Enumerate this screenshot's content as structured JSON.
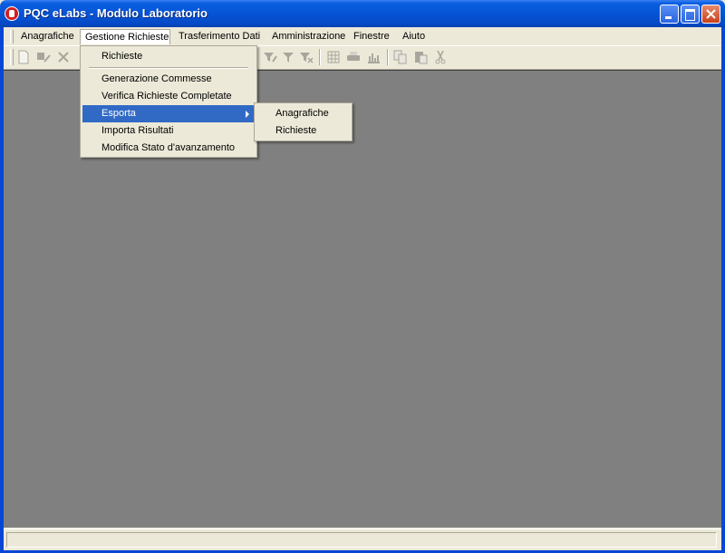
{
  "window": {
    "title": "PQC eLabs - Modulo Laboratorio",
    "active_title_color": "#0654d6"
  },
  "menubar": {
    "items": [
      {
        "label": "Anagrafiche"
      },
      {
        "label": "Gestione Richieste",
        "open": true
      },
      {
        "label": "Trasferimento Dati"
      },
      {
        "label": "Amministrazione"
      },
      {
        "label": "Finestre"
      },
      {
        "label": "Aiuto"
      }
    ]
  },
  "toolbar": {
    "icons": [
      "new-document-icon",
      "edit-icon",
      "delete-icon",
      "filter-edit-icon",
      "filter-icon",
      "filter-remove-icon",
      "table-icon",
      "print-icon",
      "chart-icon",
      "copy-icon",
      "paste-icon",
      "cut-icon"
    ],
    "enabled": false
  },
  "menu_gestione": {
    "items": [
      {
        "label": "Richieste"
      },
      {
        "label": "Generazione Commesse"
      },
      {
        "label": "Verifica Richieste Completate"
      },
      {
        "label": "Esporta",
        "highlighted": true,
        "has_submenu": true
      },
      {
        "label": "Importa Risultati"
      },
      {
        "label": "Modifica Stato d'avanzamento"
      }
    ]
  },
  "menu_esporta": {
    "items": [
      {
        "label": "Anagrafiche"
      },
      {
        "label": "Richieste"
      }
    ]
  },
  "colors": {
    "highlight": "#316ac5",
    "workspace": "#808080",
    "face": "#ece9d8"
  }
}
